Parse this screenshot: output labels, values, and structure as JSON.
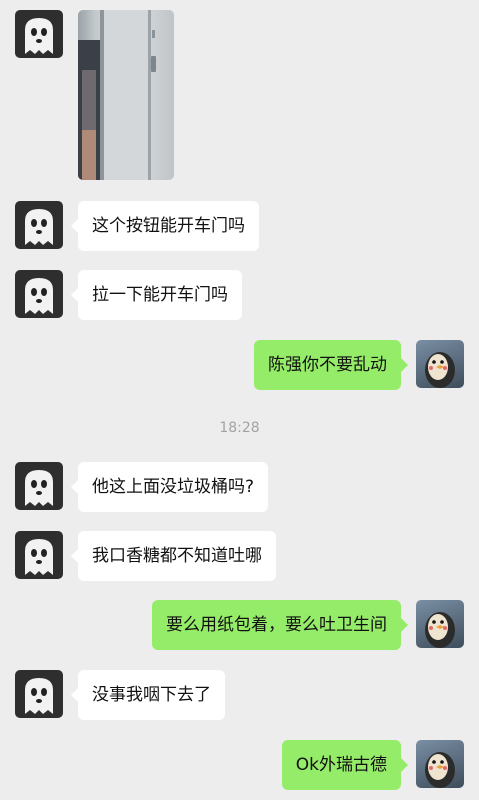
{
  "chat": {
    "timestamp": "18:28",
    "messages": [
      {
        "side": "in",
        "type": "image",
        "alt_icon": "train-door-photo"
      },
      {
        "side": "in",
        "type": "text",
        "text": "这个按钮能开车门吗"
      },
      {
        "side": "in",
        "type": "text",
        "text": "拉一下能开车门吗"
      },
      {
        "side": "out",
        "type": "text",
        "text": "陈强你不要乱动"
      },
      {
        "side": "in",
        "type": "text",
        "text": "他这上面没垃圾桶吗?"
      },
      {
        "side": "in",
        "type": "text",
        "text": "我口香糖都不知道吐哪"
      },
      {
        "side": "out",
        "type": "text",
        "text": "要么用纸包着，要么吐卫生间"
      },
      {
        "side": "in",
        "type": "text",
        "text": "没事我咽下去了"
      },
      {
        "side": "out",
        "type": "text",
        "text": "Ok外瑞古德"
      }
    ]
  },
  "colors": {
    "background": "#ededed",
    "bubble_in": "#ffffff",
    "bubble_out": "#95ec69",
    "timestamp": "#a3a3a3"
  },
  "icons": {
    "contact_avatar": "ghost-avatar-icon",
    "self_avatar": "penguin-avatar-icon"
  }
}
